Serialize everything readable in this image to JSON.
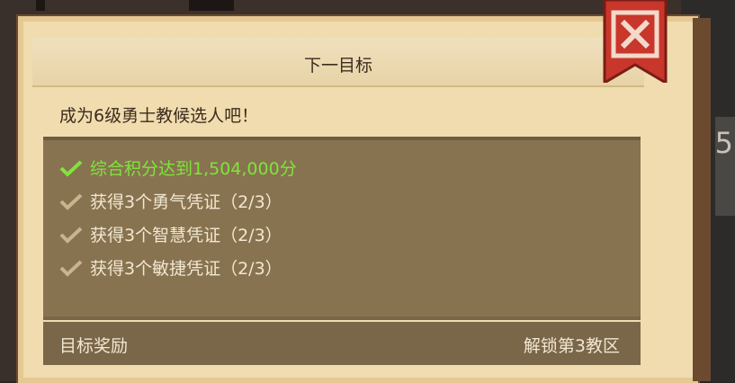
{
  "panel": {
    "title": "下一目标",
    "goal_description": "成为6级勇士教候选人吧！"
  },
  "conditions": [
    {
      "label": "综合积分达到1,504,000分",
      "completed": true
    },
    {
      "label": "获得3个勇气凭证（2/3）",
      "completed": false
    },
    {
      "label": "获得3个智慧凭证（2/3）",
      "completed": false
    },
    {
      "label": "获得3个敏捷凭证（2/3）",
      "completed": false
    }
  ],
  "reward": {
    "label": "目标奖励",
    "value": "解锁第3教区"
  },
  "background": {
    "right_edge_glyph": "5"
  },
  "colors": {
    "completed": "#7ee53a",
    "pending_check": "#c9b48e",
    "close_ribbon": "#c8362c"
  },
  "icons": {
    "close": "close-icon",
    "check": "check-icon"
  }
}
